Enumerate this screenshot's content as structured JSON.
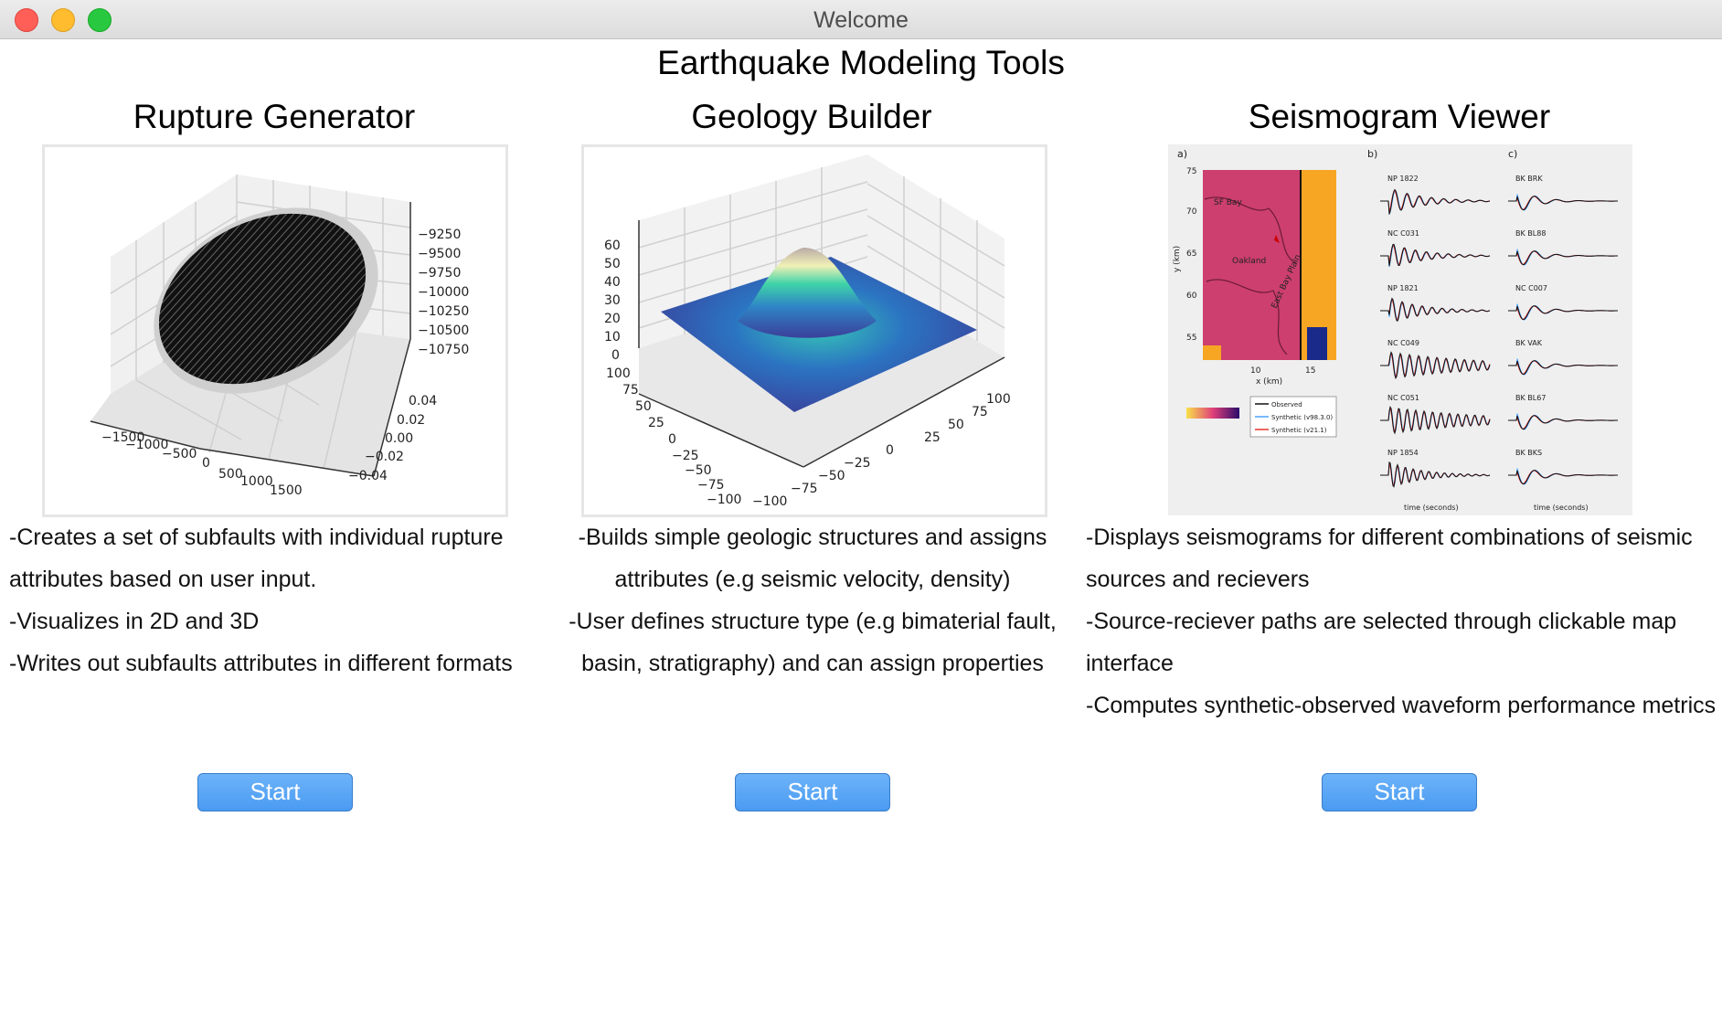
{
  "window": {
    "title": "Welcome"
  },
  "app": {
    "title": "Earthquake Modeling Tools"
  },
  "tools": [
    {
      "title": "Rupture Generator",
      "description": [
        "-Creates a set of subfaults with individual rupture attributes based on user input.",
        "-Visualizes in 2D and 3D",
        "-Writes out subfaults attributes in different formats"
      ],
      "button": "Start",
      "figure": {
        "z_ticks": [
          "−9250",
          "−9500",
          "−9750",
          "−10000",
          "−10250",
          "−10500",
          "−10750"
        ],
        "y_ticks": [
          "0.04",
          "0.02",
          "0.00",
          "−0.02",
          "−0.04"
        ],
        "x_ticks": [
          "−1500",
          "−1000",
          "−500",
          "0",
          "500",
          "1000",
          "1500"
        ]
      }
    },
    {
      "title": "Geology Builder",
      "description": [
        "-Builds simple geologic structures and assigns attributes (e.g seismic velocity, density)",
        "-User defines structure type (e.g bimaterial fault, basin, stratigraphy) and can assign properties"
      ],
      "button": "Start",
      "figure": {
        "z_ticks": [
          "60",
          "50",
          "40",
          "30",
          "20",
          "10",
          "0"
        ],
        "y_ticks": [
          "100",
          "75",
          "50",
          "25",
          "0",
          "−25",
          "−50",
          "−75",
          "−100"
        ],
        "x_ticks": [
          "−100",
          "−75",
          "−50",
          "−25",
          "0",
          "25",
          "50",
          "75",
          "100"
        ]
      }
    },
    {
      "title": "Seismogram Viewer",
      "description": [
        "-Displays seismograms for different combinations of seismic sources and recievers",
        "-Source-reciever paths are selected through clickable map interface",
        "-Computes synthetic-observed waveform performance metrics"
      ],
      "button": "Start",
      "figure": {
        "panel_labels": [
          "a)",
          "b)",
          "c)"
        ],
        "map_labels": [
          "SF Bay",
          "Oakland",
          "East Bay Plain"
        ],
        "map_y_ticks": [
          "75",
          "70",
          "65",
          "60",
          "55"
        ],
        "map_x_ticks": [
          "10",
          "15"
        ],
        "map_x_label": "x (km)",
        "map_y_label": "y (km)",
        "left_stations": [
          "NP 1822",
          "NC C031",
          "NP 1821",
          "NC C049",
          "NC C051",
          "NP 1854"
        ],
        "right_stations": [
          "BK BRK",
          "BK BL88",
          "NC C007",
          "BK VAK",
          "BK BL67",
          "BK BKS"
        ],
        "time_label": "time (seconds)",
        "legend": [
          "Observed",
          "Synthetic (v98.3.0)",
          "Synthetic (v21.1)"
        ]
      }
    }
  ],
  "colors": {
    "button": "#4a9bf2",
    "map_fill": "#cc3f6e",
    "map_fault_side": "#f6a623",
    "observed": "#111111",
    "synthetic_a": "#4aa3ff",
    "synthetic_b": "#e8322b"
  }
}
